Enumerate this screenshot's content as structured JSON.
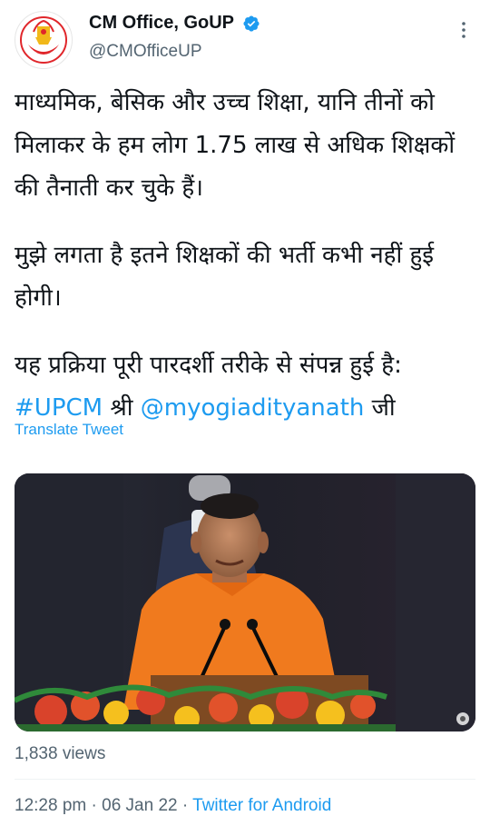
{
  "author": {
    "display_name": "CM Office, GoUP",
    "handle": "@CMOfficeUP",
    "verified": true,
    "avatar_icon": "up-government-emblem-icon"
  },
  "more_icon": "more-options-icon",
  "tweet": {
    "paragraph_1": "माध्यमिक, बेसिक और उच्च शिक्षा, यानि तीनों को मिलाकर के हम लोग 1.75 लाख से अधिक शिक्षकों की तैनाती कर चुके हैं।",
    "paragraph_2": "मुझे लगता है इतने शिक्षकों की भर्ती कभी नहीं हुई होगी।",
    "paragraph_3_text": "यह प्रक्रिया पूरी पारदर्शी तरीके से संपन्न हुई है: ",
    "hashtag": "#UPCM",
    "shri": " श्री ",
    "mention": "@myogiadityanath",
    "ji": " जी"
  },
  "translate_label": "Translate Tweet",
  "media": {
    "description_icon": "speaker-at-podium-photo"
  },
  "views": "1,838 views",
  "timestamp": {
    "time": "12:28 pm",
    "separator_1": " · ",
    "date": "06 Jan 22",
    "separator_2": " · ",
    "source": "Twitter for Android"
  },
  "colors": {
    "link": "#1d9bf0",
    "text": "#0f1419",
    "muted": "#536471",
    "orange_robe": "#f07a1e"
  }
}
